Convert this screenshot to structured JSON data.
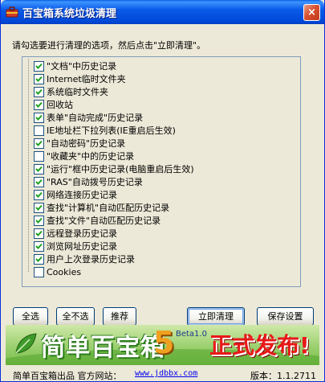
{
  "window": {
    "title": "百宝箱系统垃圾清理",
    "close_glyph": "×"
  },
  "instruction": "请勾选要进行清理的选项，然后点击\"立即清理\"。",
  "options": [
    {
      "label": "\"文档\"中历史记录",
      "checked": true
    },
    {
      "label": "Internet临时文件夹",
      "checked": true
    },
    {
      "label": "系统临时文件夹",
      "checked": true
    },
    {
      "label": "回收站",
      "checked": true
    },
    {
      "label": "表单\"自动完成\"历史记录",
      "checked": true
    },
    {
      "label": "IE地址栏下拉列表(IE重启后生效)",
      "checked": false
    },
    {
      "label": "\"自动密码\"历史记录",
      "checked": true
    },
    {
      "label": "\"收藏夹\"中的历史记录",
      "checked": false
    },
    {
      "label": "\"运行\"框中历史记录(电脑重启后生效)",
      "checked": true
    },
    {
      "label": "\"RAS\"自动拨号历史记录",
      "checked": true
    },
    {
      "label": "网络连接历史记录",
      "checked": true
    },
    {
      "label": "查找\"计算机\"自动匹配历史记录",
      "checked": true
    },
    {
      "label": "查找\"文件\"自动匹配历史记录",
      "checked": true
    },
    {
      "label": "远程登录历史记录",
      "checked": true
    },
    {
      "label": "浏览网址历史记录",
      "checked": true
    },
    {
      "label": "用户上次登录历史记录",
      "checked": true
    },
    {
      "label": "Cookies",
      "checked": false
    }
  ],
  "buttons": {
    "select_all": "全选",
    "select_none": "全不选",
    "recommend": "推荐",
    "clean_now": "立即清理",
    "save_settings": "保存设置"
  },
  "banner": {
    "text_main": "简单百宝箱",
    "version_big": "5",
    "beta": "Beta1.0",
    "release": "正式发布!"
  },
  "footer": {
    "left": "简单百宝箱出品 官方网站：",
    "link": "www.jdbbx.com",
    "version": "版本：1.1.2711"
  },
  "colors": {
    "title_bar": "#0054e3",
    "check_mark": "#21a121",
    "link": "#0000ee"
  }
}
